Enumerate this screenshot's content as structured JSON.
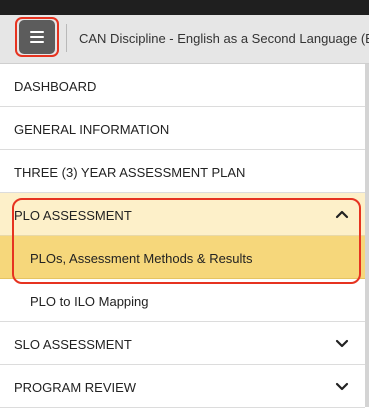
{
  "header": {
    "menu_icon": "hamburger-menu-icon",
    "course_title": "CAN Discipline - English as a Second Language (E"
  },
  "nav": {
    "items": [
      {
        "label": "DASHBOARD"
      },
      {
        "label": "GENERAL INFORMATION"
      },
      {
        "label": "THREE (3) YEAR ASSESSMENT PLAN"
      },
      {
        "label": "PLO ASSESSMENT",
        "state": "expanded",
        "icon": "chevron-up-icon"
      },
      {
        "label": "PLOs, Assessment Methods & Results",
        "state": "active-subitem"
      },
      {
        "label": "PLO to ILO Mapping",
        "state": "subitem"
      },
      {
        "label": "SLO ASSESSMENT",
        "state": "collapsed",
        "icon": "chevron-down-icon"
      },
      {
        "label": "PROGRAM REVIEW",
        "state": "collapsed",
        "icon": "chevron-down-icon"
      }
    ]
  },
  "colors": {
    "topbar_bg": "#e6e6e6",
    "menu_button_bg": "#5c5c5c",
    "highlight_border": "#e63320",
    "expanded_bg": "#fdf0c9",
    "active_bg": "#f6d77b",
    "divider": "#dcdcdc"
  }
}
